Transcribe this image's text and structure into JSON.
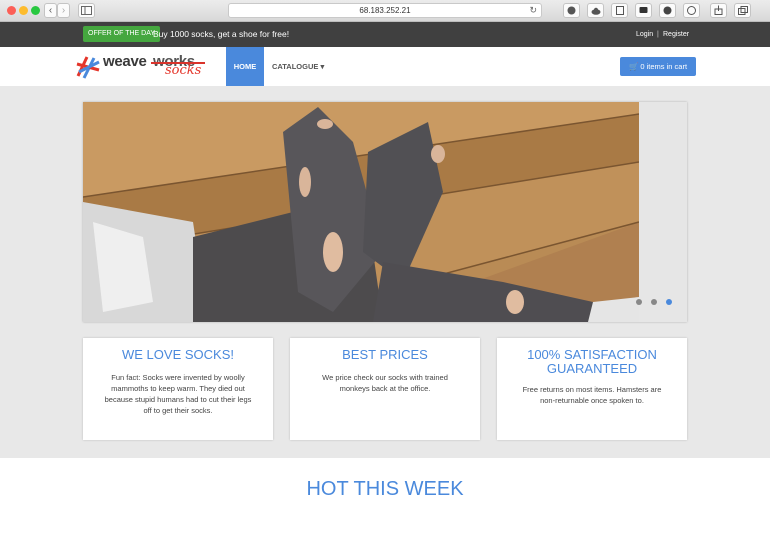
{
  "browser": {
    "url": "68.183.252.21",
    "reload_glyph": "↻",
    "back_glyph": "‹",
    "forward_glyph": "›"
  },
  "topbar": {
    "offer_badge": "OFFER OF THE DAY",
    "offer_text": "Buy 1000 socks, get a shoe for free!",
    "login": "Login",
    "separator": "|",
    "register": "Register"
  },
  "logo": {
    "weave": "weave",
    "works": "works",
    "socks": "socks"
  },
  "nav": {
    "home": "HOME",
    "catalogue": "CATALOGUE ▾",
    "cart": "🛒 0 items in cart"
  },
  "carousel": {
    "active_index": 2,
    "count": 3,
    "active_color": "#4a89dc",
    "inactive_color": "#888888"
  },
  "cards": [
    {
      "title": "WE LOVE SOCKS!",
      "text": "Fun fact: Socks were invented by woolly mammoths to keep warm. They died out because stupid humans had to cut their legs off to get their socks."
    },
    {
      "title": "BEST PRICES",
      "text": "We price check our socks with trained monkeys back at the office."
    },
    {
      "title": "100% SATISFACTION GUARANTEED",
      "text": "Free returns on most items. Hamsters are non-returnable once spoken to."
    }
  ],
  "hot": {
    "title": "HOT THIS WEEK"
  },
  "colors": {
    "accent": "#4a89dc",
    "topbar": "#404040",
    "offer": "#45a73f",
    "logo_red": "#e4352a"
  }
}
